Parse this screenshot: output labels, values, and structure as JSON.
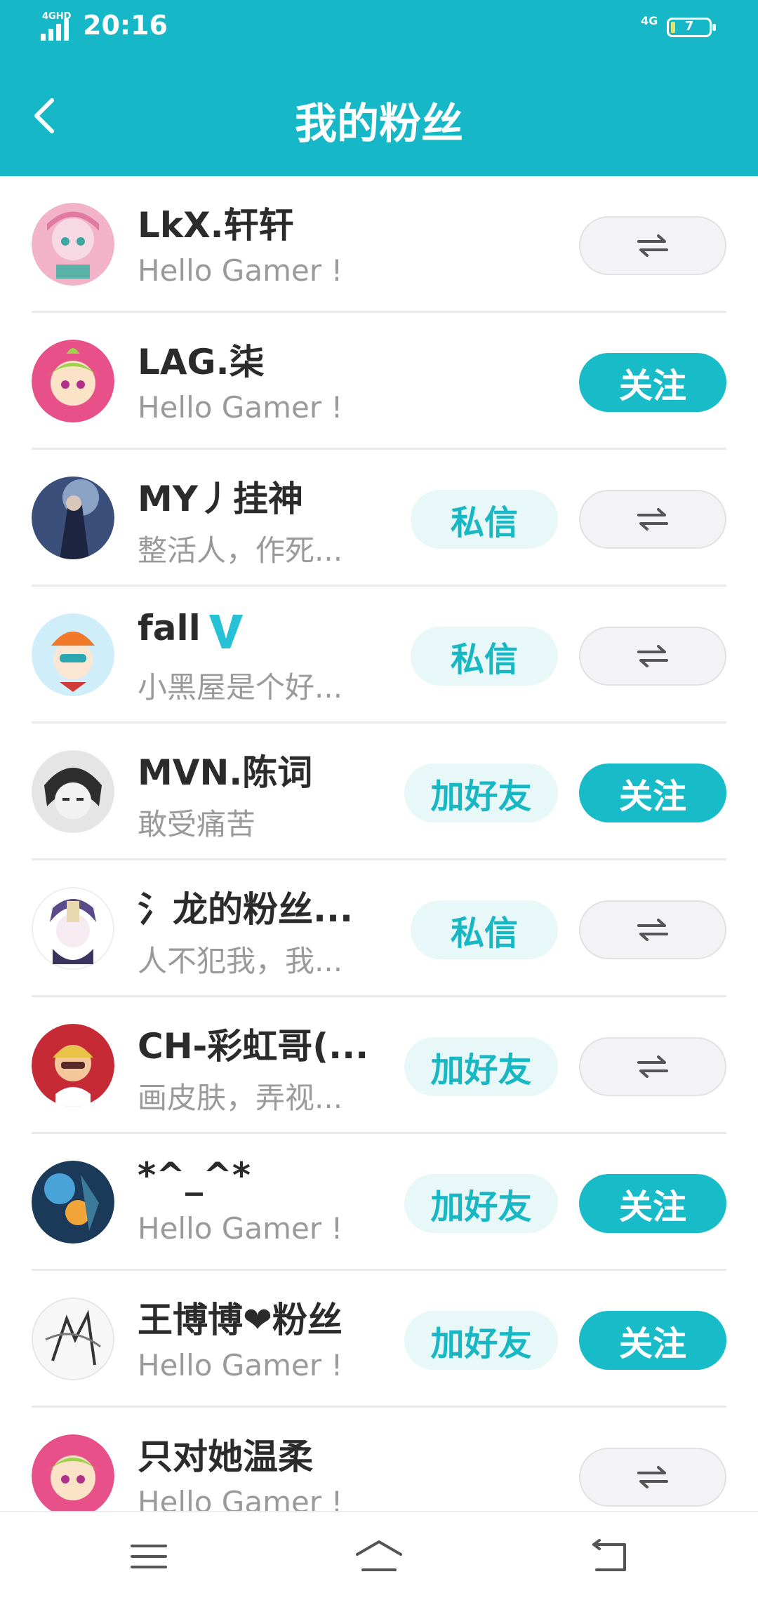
{
  "status_bar": {
    "network": "4GHD",
    "time": "20:16",
    "network_right": "4G",
    "battery": "7"
  },
  "header": {
    "title": "我的粉丝"
  },
  "swap_icon": "⇌",
  "fans": [
    {
      "name": "LkX.轩轩",
      "signature": "Hello Gamer !",
      "left_button": "",
      "right_button": "⇌",
      "verified": false
    },
    {
      "name": "LAG.柒",
      "signature": "Hello Gamer !",
      "left_button": "",
      "right_button": "关注",
      "verified": false
    },
    {
      "name": "MY丿挂神",
      "signature": "整活人，作死...",
      "left_button": "私信",
      "right_button": "⇌",
      "verified": false
    },
    {
      "name": "fall",
      "signature": "小黑屋是个好...",
      "left_button": "私信",
      "right_button": "⇌",
      "verified": true
    },
    {
      "name": "MVN.陈词",
      "signature": "敢受痛苦",
      "left_button": "加好友",
      "right_button": "关注",
      "verified": false
    },
    {
      "name": "氵龙的粉丝...",
      "signature": "人不犯我，我...",
      "left_button": "私信",
      "right_button": "⇌",
      "verified": false
    },
    {
      "name": "CH-彩虹哥(...",
      "signature": "画皮肤，弄视...",
      "left_button": "加好友",
      "right_button": "⇌",
      "verified": false
    },
    {
      "name": "*^_^*",
      "signature": "Hello Gamer !",
      "left_button": "加好友",
      "right_button": "关注",
      "verified": false
    },
    {
      "name": "王博博❤粉丝",
      "signature": "Hello Gamer !",
      "left_button": "加好友",
      "right_button": "关注",
      "verified": false
    },
    {
      "name": "只对她温柔",
      "signature": "Hello Gamer !",
      "left_button": "",
      "right_button": "⇌",
      "verified": false
    }
  ],
  "nav": {
    "menu_icon": "menu-icon",
    "home_icon": "home-icon",
    "back_icon": "back-icon"
  },
  "colors": {
    "accent": "#16b8c7",
    "follow_button": "#18bcc8",
    "light_button": "#e8f7f8",
    "swap_button": "#f3f3f5"
  }
}
